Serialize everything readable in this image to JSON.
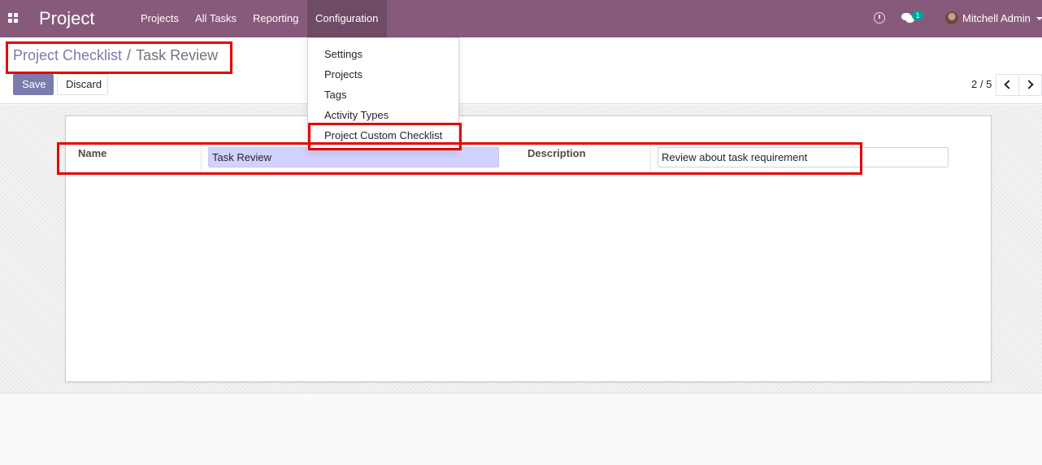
{
  "navbar": {
    "brand": "Project",
    "menu": [
      "Projects",
      "All Tasks",
      "Reporting",
      "Configuration"
    ],
    "active_menu": "Configuration",
    "notification_count": "1",
    "user_name": "Mitchell Admin",
    "background_color": "#875a7b",
    "icons": [
      "apps-grid-icon",
      "clock-icon",
      "chat-icon",
      "caret-down-icon"
    ]
  },
  "breadcrumb": {
    "parent": "Project Checklist",
    "separator": "/",
    "current": "Task Review"
  },
  "actions": {
    "save_label": "Save",
    "discard_label": "Discard",
    "save_color": "#7c7bad"
  },
  "pager": {
    "value": "2 / 5",
    "icons": [
      "chevron-left-icon",
      "chevron-right-icon"
    ]
  },
  "configuration_menu": {
    "items": [
      "Settings",
      "Projects",
      "Tags",
      "Activity Types",
      "Project Custom Checklist"
    ]
  },
  "form": {
    "name_label": "Name",
    "name_value": "Task Review",
    "description_label": "Description",
    "description_value": "Review about task requirement"
  },
  "highlight_color": "#e60000"
}
